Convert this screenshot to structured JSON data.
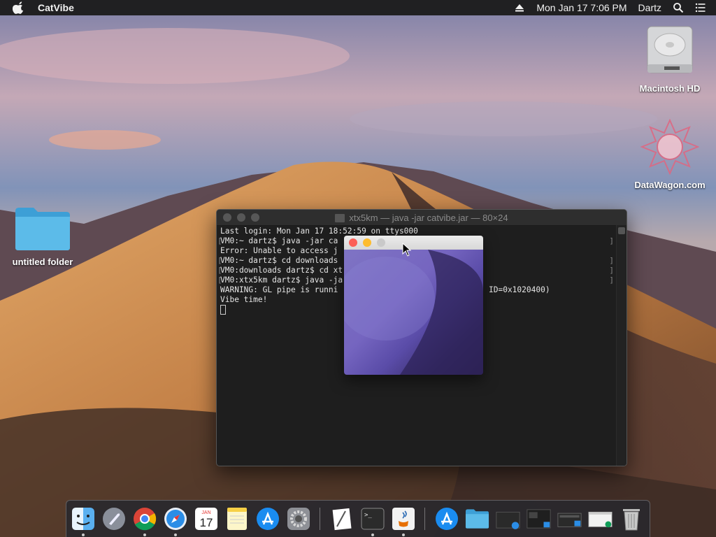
{
  "menubar": {
    "app_name": "CatVibe",
    "datetime": "Mon Jan 17  7:06 PM",
    "user": "Dartz"
  },
  "desktop_icons": {
    "hd_label": "Macintosh HD",
    "datawagon_label": "DataWagon.com",
    "folder_label": "untitled folder"
  },
  "terminal": {
    "title": "xtx5km — java -jar catvibe.jar — 80×24",
    "lines": [
      "Last login: Mon Jan 17 18:52:59 on ttys000",
      "VM0:~ dartz$ java -jar ca",
      "Error: Unable to access j",
      "VM0:~ dartz$ cd downloads",
      "VM0:downloads dartz$ cd xt",
      "VM0:xtx5km dartz$ java -ja",
      "WARNING: GL pipe is runni",
      "Vibe time!"
    ],
    "warning_suffix": "ID=0x1020400)"
  },
  "dock": {
    "calendar_month": "JAN",
    "calendar_day": "17",
    "terminal_prompt": ">_"
  },
  "colors": {
    "close": "#fc5f57",
    "minimize": "#fdbc2e",
    "maximize_inactive": "#c9c9c9"
  }
}
